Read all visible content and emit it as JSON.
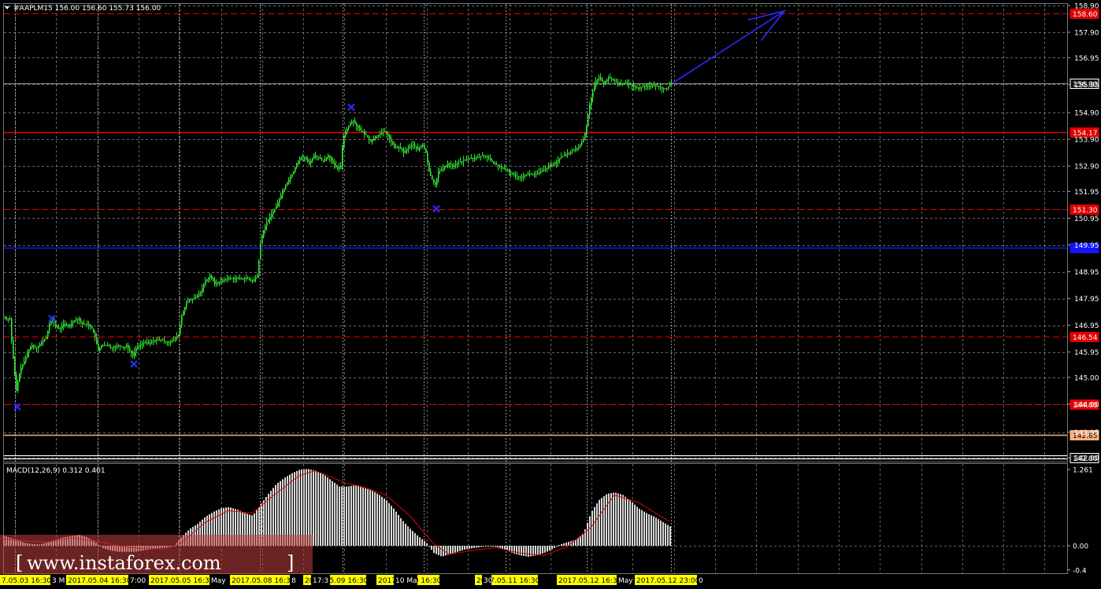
{
  "header": {
    "symbol_line": "#AAPLM15  156.00 156.60 155.73 156.00",
    "macd_line": "MACD(12,26,9) 0.312 0.401"
  },
  "watermark": "www.instaforex.com",
  "colors": {
    "background": "#000000",
    "grid": "#8a8a8a",
    "candle": "#32e632",
    "resistance_line": "#e00000",
    "blue_line": "#1414ff",
    "arrow": "#2a2aff",
    "marker": "#2a2aff",
    "orange_line": "#ffb080",
    "macd_hist": "#d8d8d8",
    "macd_signal": "#e00000",
    "date_tag": "#ffff00"
  },
  "chart_data": {
    "type": "candlestick",
    "instrument": "#AAPLM15",
    "ohlc_current": {
      "open": 156.0,
      "high": 156.6,
      "low": 155.73,
      "close": 156.0
    },
    "ylim": [
      141.95,
      159.0
    ],
    "y_ticks": [
      "158.90",
      "157.90",
      "156.95",
      "155.95",
      "154.90",
      "153.90",
      "152.90",
      "151.95",
      "150.95",
      "149.95",
      "148.95",
      "147.95",
      "146.95",
      "145.95",
      "145.00",
      "144.00",
      "142.95",
      "142.00"
    ],
    "y_tick_values": [
      158.9,
      157.9,
      156.95,
      155.95,
      154.9,
      153.9,
      152.9,
      151.95,
      150.95,
      149.95,
      148.95,
      147.95,
      146.95,
      145.95,
      145.0,
      144.0,
      142.95,
      142.0
    ],
    "levels": [
      {
        "value": 158.6,
        "label": "158.60",
        "style": "dashed",
        "color": "#e00000"
      },
      {
        "value": 156.0,
        "label": "156.00",
        "style": "solid",
        "color": "#9a9a9a"
      },
      {
        "value": 154.17,
        "label": "154.17",
        "style": "solid",
        "color": "#e00000"
      },
      {
        "value": 151.3,
        "label": "151.30",
        "style": "dashed",
        "color": "#e00000"
      },
      {
        "value": 149.85,
        "label": "149.85",
        "style": "solid",
        "color": "#1414ff"
      },
      {
        "value": 146.54,
        "label": "146.54",
        "style": "dashed",
        "color": "#e00000"
      },
      {
        "value": 144.0,
        "label": "144.00",
        "style": "dashed",
        "color": "#e00000"
      },
      {
        "value": 142.85,
        "label": "142.85",
        "style": "solid",
        "color": "#ffb080"
      },
      {
        "value": 142.0,
        "label": "142.00",
        "style": "double",
        "color": "#ffffff"
      }
    ],
    "price_path": [
      [
        0,
        147.3
      ],
      [
        3,
        147.3
      ],
      [
        6,
        147.2
      ],
      [
        12,
        147.2
      ],
      [
        15,
        146.0
      ],
      [
        20,
        144.5
      ],
      [
        25,
        145.3
      ],
      [
        30,
        145.6
      ],
      [
        35,
        146.0
      ],
      [
        40,
        146.2
      ],
      [
        46,
        146.1
      ],
      [
        52,
        146.3
      ],
      [
        58,
        146.5
      ],
      [
        62,
        147.0
      ],
      [
        66,
        147.2
      ],
      [
        70,
        146.9
      ],
      [
        75,
        146.8
      ],
      [
        80,
        147.0
      ],
      [
        86,
        146.9
      ],
      [
        92,
        147.1
      ],
      [
        98,
        147.2
      ],
      [
        104,
        147.0
      ],
      [
        110,
        147.0
      ],
      [
        115,
        146.9
      ],
      [
        120,
        146.5
      ],
      [
        124,
        146.0
      ],
      [
        128,
        146.2
      ],
      [
        135,
        146.2
      ],
      [
        142,
        146.1
      ],
      [
        150,
        146.2
      ],
      [
        156,
        146.1
      ],
      [
        160,
        146.2
      ],
      [
        164,
        146.0
      ],
      [
        168,
        145.8
      ],
      [
        172,
        146.1
      ],
      [
        176,
        146.2
      ],
      [
        182,
        146.3
      ],
      [
        190,
        146.3
      ],
      [
        196,
        146.4
      ],
      [
        204,
        146.4
      ],
      [
        212,
        146.3
      ],
      [
        220,
        146.4
      ],
      [
        226,
        146.6
      ],
      [
        230,
        147.3
      ],
      [
        236,
        147.8
      ],
      [
        242,
        147.9
      ],
      [
        248,
        148.0
      ],
      [
        254,
        148.2
      ],
      [
        260,
        148.6
      ],
      [
        266,
        148.8
      ],
      [
        272,
        148.5
      ],
      [
        280,
        148.6
      ],
      [
        288,
        148.7
      ],
      [
        296,
        148.7
      ],
      [
        304,
        148.7
      ],
      [
        312,
        148.7
      ],
      [
        320,
        148.6
      ],
      [
        326,
        148.8
      ],
      [
        330,
        150.0
      ],
      [
        334,
        150.5
      ],
      [
        338,
        150.8
      ],
      [
        342,
        151.0
      ],
      [
        346,
        151.2
      ],
      [
        350,
        151.4
      ],
      [
        356,
        151.8
      ],
      [
        362,
        152.2
      ],
      [
        368,
        152.5
      ],
      [
        372,
        152.7
      ],
      [
        376,
        153.0
      ],
      [
        380,
        153.2
      ],
      [
        386,
        153.2
      ],
      [
        392,
        153.0
      ],
      [
        398,
        153.3
      ],
      [
        404,
        153.2
      ],
      [
        410,
        153.1
      ],
      [
        416,
        153.3
      ],
      [
        422,
        153.0
      ],
      [
        428,
        152.8
      ],
      [
        432,
        152.9
      ],
      [
        435,
        154.0
      ],
      [
        440,
        154.3
      ],
      [
        444,
        154.5
      ],
      [
        448,
        154.6
      ],
      [
        452,
        154.4
      ],
      [
        458,
        154.2
      ],
      [
        462,
        154.1
      ],
      [
        466,
        154.0
      ],
      [
        470,
        153.8
      ],
      [
        476,
        154.0
      ],
      [
        482,
        154.1
      ],
      [
        488,
        154.2
      ],
      [
        494,
        153.9
      ],
      [
        500,
        153.6
      ],
      [
        506,
        153.6
      ],
      [
        512,
        153.4
      ],
      [
        518,
        153.6
      ],
      [
        524,
        153.7
      ],
      [
        530,
        153.5
      ],
      [
        536,
        153.7
      ],
      [
        540,
        153.4
      ],
      [
        544,
        152.7
      ],
      [
        548,
        152.4
      ],
      [
        552,
        152.2
      ],
      [
        556,
        152.7
      ],
      [
        562,
        152.8
      ],
      [
        568,
        153.0
      ],
      [
        574,
        152.9
      ],
      [
        580,
        153.0
      ],
      [
        588,
        153.1
      ],
      [
        596,
        153.2
      ],
      [
        604,
        153.2
      ],
      [
        612,
        153.3
      ],
      [
        620,
        153.2
      ],
      [
        626,
        153.0
      ],
      [
        632,
        152.9
      ],
      [
        638,
        152.8
      ],
      [
        644,
        152.7
      ],
      [
        650,
        152.6
      ],
      [
        656,
        152.5
      ],
      [
        662,
        152.5
      ],
      [
        668,
        152.6
      ],
      [
        674,
        152.6
      ],
      [
        680,
        152.6
      ],
      [
        686,
        152.7
      ],
      [
        692,
        152.8
      ],
      [
        698,
        152.9
      ],
      [
        704,
        153.0
      ],
      [
        710,
        153.2
      ],
      [
        716,
        153.3
      ],
      [
        722,
        153.4
      ],
      [
        728,
        153.5
      ],
      [
        734,
        153.6
      ],
      [
        740,
        153.9
      ],
      [
        744,
        154.4
      ],
      [
        748,
        155.2
      ],
      [
        752,
        155.7
      ],
      [
        756,
        156.1
      ],
      [
        760,
        156.2
      ],
      [
        766,
        156.0
      ],
      [
        772,
        156.2
      ],
      [
        778,
        156.1
      ],
      [
        786,
        156.0
      ],
      [
        794,
        156.0
      ],
      [
        802,
        155.9
      ],
      [
        810,
        155.8
      ],
      [
        818,
        155.9
      ],
      [
        826,
        155.9
      ],
      [
        834,
        155.9
      ],
      [
        840,
        155.8
      ],
      [
        846,
        155.8
      ],
      [
        852,
        156.0
      ]
    ],
    "markers": [
      {
        "x": 22,
        "value": 143.9
      },
      {
        "x": 66,
        "value": 147.2
      },
      {
        "x": 170,
        "value": 145.5
      },
      {
        "x": 446,
        "value": 155.1
      },
      {
        "x": 554,
        "value": 151.3
      }
    ],
    "forecast_arrow": {
      "from": [
        854,
        156.0
      ],
      "to": [
        996,
        158.7
      ]
    },
    "x_labels": [
      "7.05.03 16:30",
      "3 M",
      "2017.05.04 16:30",
      "7:00",
      "2017.05.05 16:30",
      "May",
      "2017.05.08 16:30",
      "8",
      "2017.05.09 16:30",
      "17:3",
      "2017.05.10 16:30",
      "10 Ma",
      "2017.05.11 16:30",
      "30",
      "2017.05.12 16:30",
      "May",
      "2017.05.12 23:00",
      "0"
    ],
    "macd": {
      "params": "12,26,9",
      "main": 0.312,
      "signal": 0.401,
      "ylim": [
        -0.4,
        1.4
      ],
      "y_ticks": [
        "1.261",
        "0.00",
        "-0.4"
      ],
      "y_tick_values": [
        1.261,
        0.0,
        -0.4
      ],
      "histogram": [
        [
          0,
          0.18
        ],
        [
          10,
          0.14
        ],
        [
          20,
          0.1
        ],
        [
          30,
          0.05
        ],
        [
          40,
          0.03
        ],
        [
          50,
          0.02
        ],
        [
          60,
          0.06
        ],
        [
          70,
          0.1
        ],
        [
          80,
          0.14
        ],
        [
          90,
          0.16
        ],
        [
          100,
          0.18
        ],
        [
          110,
          0.14
        ],
        [
          120,
          0.06
        ],
        [
          130,
          -0.04
        ],
        [
          140,
          -0.08
        ],
        [
          150,
          -0.1
        ],
        [
          160,
          -0.1
        ],
        [
          170,
          -0.1
        ],
        [
          180,
          -0.08
        ],
        [
          190,
          -0.06
        ],
        [
          200,
          -0.04
        ],
        [
          210,
          -0.03
        ],
        [
          220,
          0.0
        ],
        [
          230,
          0.15
        ],
        [
          240,
          0.28
        ],
        [
          250,
          0.36
        ],
        [
          260,
          0.48
        ],
        [
          270,
          0.56
        ],
        [
          280,
          0.62
        ],
        [
          290,
          0.64
        ],
        [
          300,
          0.6
        ],
        [
          310,
          0.54
        ],
        [
          320,
          0.5
        ],
        [
          330,
          0.68
        ],
        [
          340,
          0.86
        ],
        [
          350,
          1.02
        ],
        [
          360,
          1.12
        ],
        [
          370,
          1.2
        ],
        [
          380,
          1.26
        ],
        [
          390,
          1.27
        ],
        [
          400,
          1.24
        ],
        [
          410,
          1.18
        ],
        [
          420,
          1.08
        ],
        [
          430,
          0.98
        ],
        [
          440,
          0.98
        ],
        [
          450,
          1.0
        ],
        [
          460,
          0.96
        ],
        [
          470,
          0.92
        ],
        [
          480,
          0.85
        ],
        [
          490,
          0.75
        ],
        [
          500,
          0.6
        ],
        [
          510,
          0.42
        ],
        [
          520,
          0.28
        ],
        [
          530,
          0.16
        ],
        [
          540,
          0.06
        ],
        [
          550,
          -0.12
        ],
        [
          560,
          -0.18
        ],
        [
          570,
          -0.14
        ],
        [
          580,
          -0.1
        ],
        [
          590,
          -0.06
        ],
        [
          600,
          -0.04
        ],
        [
          610,
          -0.02
        ],
        [
          620,
          0.0
        ],
        [
          630,
          -0.02
        ],
        [
          640,
          -0.06
        ],
        [
          650,
          -0.12
        ],
        [
          660,
          -0.16
        ],
        [
          670,
          -0.18
        ],
        [
          680,
          -0.16
        ],
        [
          690,
          -0.12
        ],
        [
          700,
          -0.06
        ],
        [
          710,
          0.02
        ],
        [
          720,
          0.06
        ],
        [
          730,
          0.1
        ],
        [
          740,
          0.2
        ],
        [
          750,
          0.56
        ],
        [
          760,
          0.76
        ],
        [
          770,
          0.86
        ],
        [
          780,
          0.88
        ],
        [
          790,
          0.84
        ],
        [
          800,
          0.74
        ],
        [
          810,
          0.62
        ],
        [
          820,
          0.54
        ],
        [
          830,
          0.48
        ],
        [
          840,
          0.4
        ],
        [
          850,
          0.32
        ]
      ],
      "signal_line": [
        [
          0,
          0.12
        ],
        [
          30,
          0.08
        ],
        [
          60,
          0.06
        ],
        [
          90,
          0.13
        ],
        [
          120,
          0.08
        ],
        [
          150,
          0.0
        ],
        [
          180,
          -0.05
        ],
        [
          210,
          -0.05
        ],
        [
          230,
          0.04
        ],
        [
          260,
          0.38
        ],
        [
          290,
          0.58
        ],
        [
          320,
          0.54
        ],
        [
          350,
          0.86
        ],
        [
          380,
          1.16
        ],
        [
          400,
          1.24
        ],
        [
          420,
          1.14
        ],
        [
          440,
          1.03
        ],
        [
          460,
          0.98
        ],
        [
          490,
          0.84
        ],
        [
          520,
          0.5
        ],
        [
          550,
          0.04
        ],
        [
          570,
          -0.14
        ],
        [
          600,
          -0.08
        ],
        [
          630,
          -0.03
        ],
        [
          660,
          -0.12
        ],
        [
          690,
          -0.16
        ],
        [
          720,
          -0.02
        ],
        [
          750,
          0.3
        ],
        [
          780,
          0.84
        ],
        [
          810,
          0.72
        ],
        [
          850,
          0.4
        ]
      ]
    }
  }
}
